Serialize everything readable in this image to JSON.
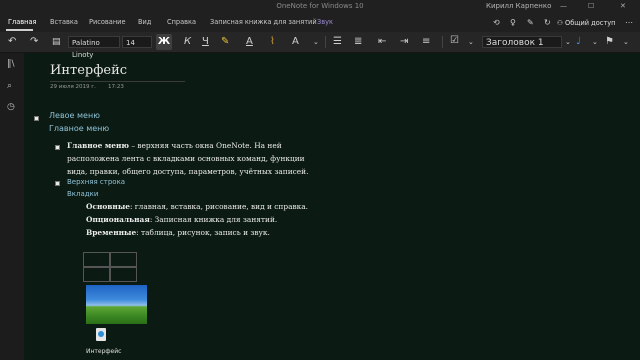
{
  "window": {
    "title": "OneNote for Windows 10",
    "user": "Кирилл Карпенко",
    "minimize": "—",
    "maximize": "☐",
    "close": "✕"
  },
  "tabs": [
    {
      "label": "Главная",
      "active": true
    },
    {
      "label": "Вставка"
    },
    {
      "label": "Рисование"
    },
    {
      "label": "Вид"
    },
    {
      "label": "Справка"
    },
    {
      "label": "Записная книжка для занятий"
    },
    {
      "label": "Звук"
    }
  ],
  "top_right": {
    "share": "Общий доступ"
  },
  "ribbon": {
    "font_name": "Palatino Linoty",
    "font_size": "14",
    "bold": "Ж",
    "italic": "К",
    "underline": "Ч",
    "style": "Заголовок 1"
  },
  "page": {
    "title": "Интерфейс",
    "date": "29 июля 2019 г.",
    "time": "17:23",
    "heading1": "Левое меню",
    "heading2": "Главное меню",
    "para1": {
      "bold": "Главное меню",
      "line1": " – верхняя часть окна OneNote. На ней",
      "line2": "расположена лента с вкладками основных команд, функции",
      "line3": "вида, правки, общего доступа, параметров, учётных записей."
    },
    "sub1": "Верхняя строка",
    "sub2": "Вкладки",
    "items": [
      {
        "label": "Основные",
        "text": ": главная, вставка, рисование, вид и справка."
      },
      {
        "label": "Опциональная",
        "text": ": Записная книжка для занятий."
      },
      {
        "label": "Временные",
        "text": ": таблица, рисунок, запись и звук."
      }
    ],
    "attachment_label": "Интерфейс"
  }
}
